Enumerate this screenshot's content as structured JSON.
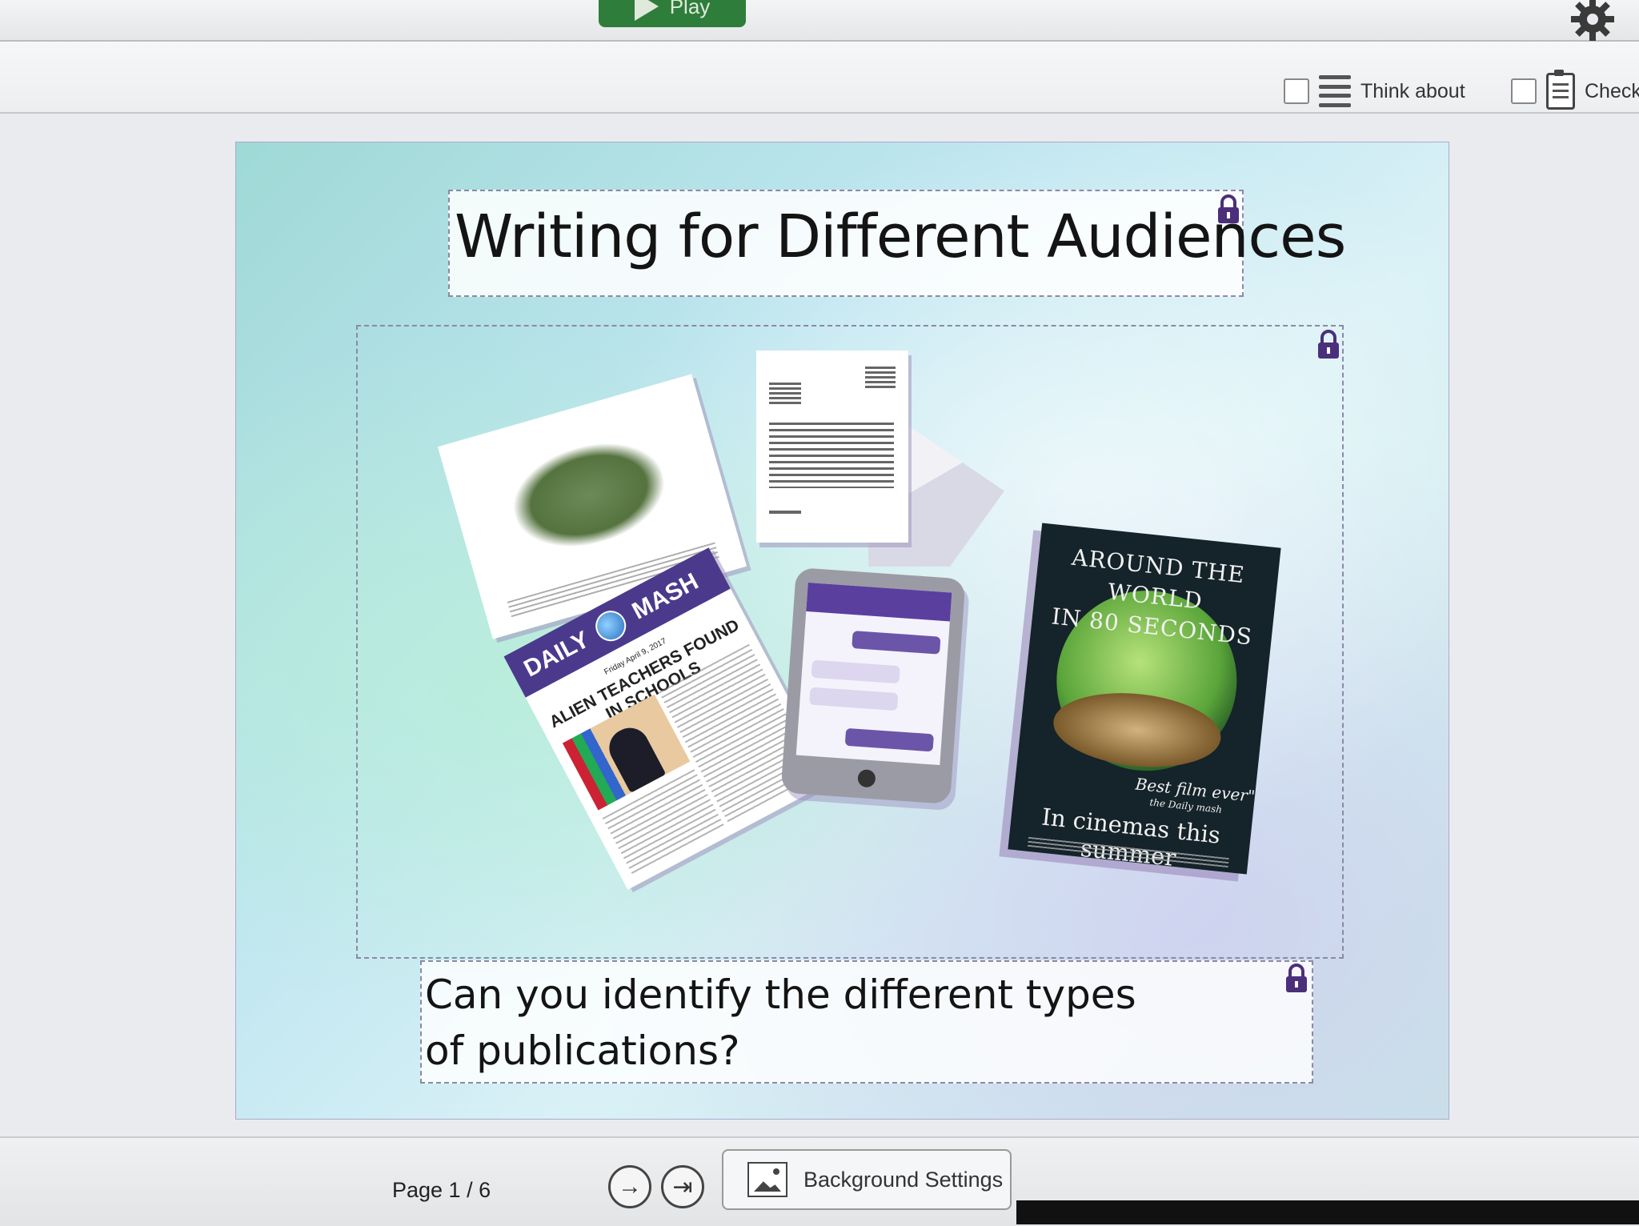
{
  "top": {
    "play_label": "Play",
    "settings_icon": "gear-icon"
  },
  "toolbar": {
    "think_about_label": "Think about",
    "check_label": "Check"
  },
  "slide": {
    "title": "Writing for Different Audiences",
    "question": "Can you identify the different types of publications?",
    "newspaper": {
      "masthead_left": "DAILY",
      "masthead_right": "MASH",
      "date": "Friday April 9, 2017",
      "headline": "ALIEN TEACHERS FOUND IN SCHOOLS"
    },
    "poster": {
      "title_line1": "AROUND THE WORLD",
      "title_line2": "IN 80 SECONDS",
      "quote": "Best film ever\"",
      "quote_source": "the Daily mash",
      "tagline": "In cinemas this summer"
    }
  },
  "footer": {
    "page_label": "Page 1 / 6",
    "next_icon": "arrow-right-circle-icon",
    "last_icon": "arrow-to-end-circle-icon",
    "background_settings_label": "Background Settings"
  },
  "colors": {
    "play_green": "#2f7d3a",
    "lock_purple": "#4b2f7a",
    "newspaper_purple": "#4b3a8c"
  }
}
